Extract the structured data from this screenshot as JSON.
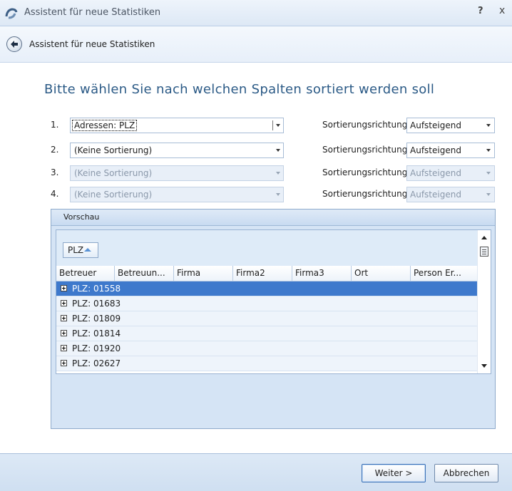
{
  "window": {
    "title": "Assistent für neue Statistiken",
    "help_glyph": "?",
    "close_glyph": "x"
  },
  "subheader": {
    "title": "Assistent für neue Statistiken"
  },
  "heading": "Bitte wählen Sie nach welchen Spalten sortiert werden soll",
  "sort_rows": [
    {
      "num": "1.",
      "column": "Adressen: PLZ",
      "dir_label": "Sortierungsrichtung",
      "direction": "Aufsteigend",
      "enabled": true
    },
    {
      "num": "2.",
      "column": "(Keine Sortierung)",
      "dir_label": "Sortierungsrichtung",
      "direction": "Aufsteigend",
      "enabled": true
    },
    {
      "num": "3.",
      "column": "(Keine Sortierung)",
      "dir_label": "Sortierungsrichtung",
      "direction": "Aufsteigend",
      "enabled": false
    },
    {
      "num": "4.",
      "column": "(Keine Sortierung)",
      "dir_label": "Sortierungsrichtung",
      "direction": "Aufsteigend",
      "enabled": false
    }
  ],
  "preview": {
    "title": "Vorschau",
    "group_chip": "PLZ",
    "columns": [
      "Betreuer",
      "Betreuun...",
      "Firma",
      "Firma2",
      "Firma3",
      "Ort",
      "Person Er..."
    ],
    "groups": [
      "PLZ: 01558",
      "PLZ: 01683",
      "PLZ: 01809",
      "PLZ: 01814",
      "PLZ: 01920",
      "PLZ: 02627"
    ],
    "selected_group": "PLZ: 01558"
  },
  "footer": {
    "next_label": "Weiter >",
    "cancel_label": "Abbrechen"
  },
  "colors": {
    "accent": "#2b5a86",
    "selection": "#3e79cc",
    "panel": "#d5e4f5"
  }
}
